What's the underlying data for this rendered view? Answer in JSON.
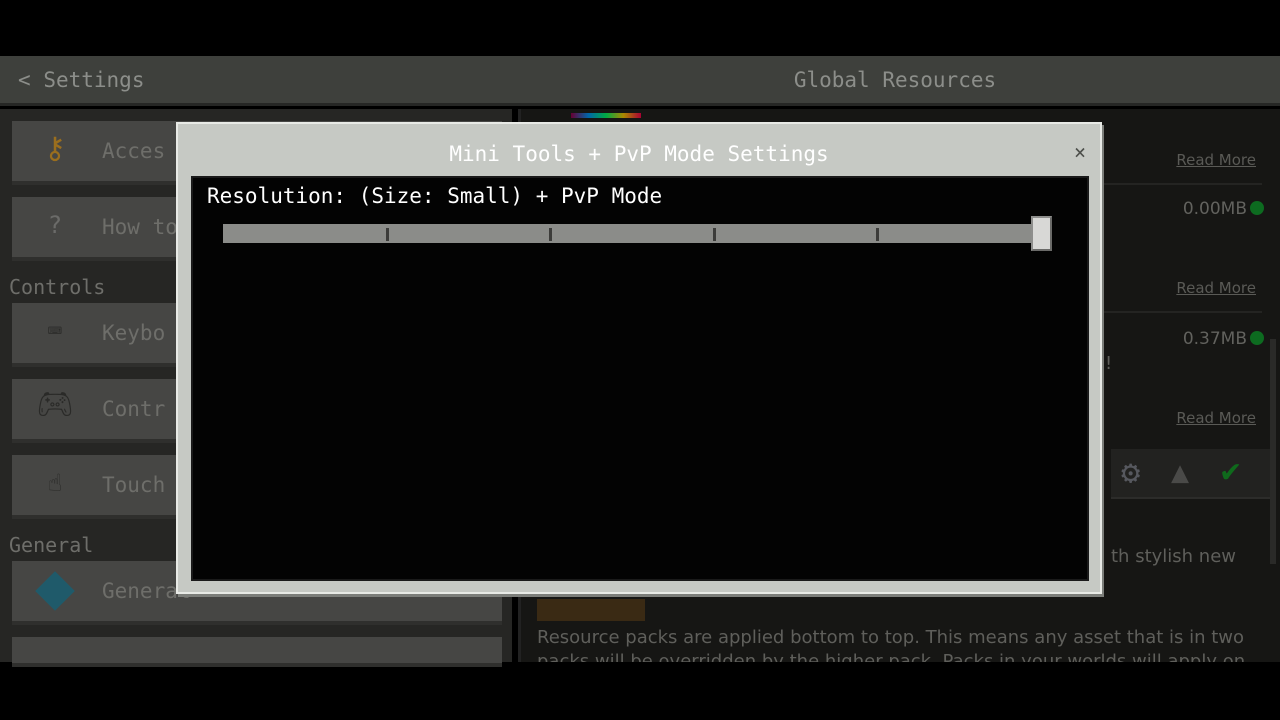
{
  "header": {
    "back_label": "Settings",
    "title": "Global Resources"
  },
  "sidebar": {
    "items_top": [
      {
        "label": "Acces",
        "icon": "key-icon"
      },
      {
        "label": "How to",
        "icon": "question-icon"
      }
    ],
    "controls_label": "Controls",
    "controls": [
      {
        "label": "Keybo",
        "icon": "keyboard-mouse-icon"
      },
      {
        "label": "Contr",
        "icon": "gamepad-icon"
      },
      {
        "label": "Touch",
        "icon": "touch-icon"
      }
    ],
    "general_label": "General",
    "general": [
      {
        "label": "General",
        "icon": "cube-icon"
      }
    ]
  },
  "packs": {
    "read_more": "Read More",
    "sizes": [
      "0.00MB",
      "0.37MB"
    ],
    "status_color": "#0d6b20",
    "exclaim": "!",
    "desc_fragment": "th stylish new",
    "footer_text_1": "Resource packs are applied bottom to top. This means any asset that is in two",
    "footer_text_2": "packs will be overridden by the higher pack. Packs in your worlds will apply on"
  },
  "modal": {
    "title": "Mini Tools + PvP Mode Settings",
    "close": "×",
    "setting_label": "Resolution: (Size: Small) + PvP Mode",
    "slider": {
      "steps": 5,
      "value": 5,
      "fraction": 1.0
    }
  }
}
